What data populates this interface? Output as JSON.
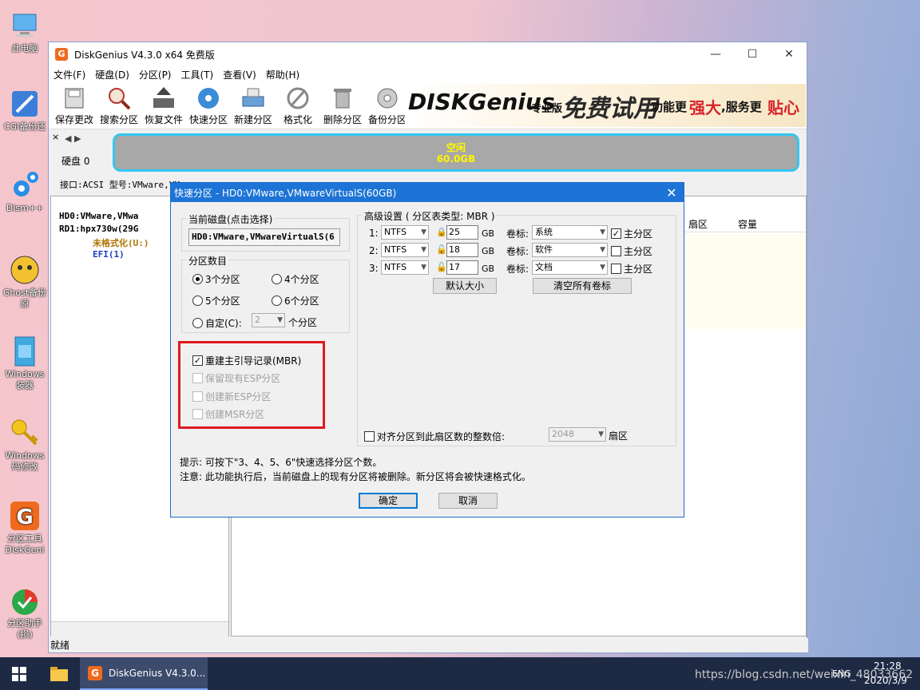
{
  "desktop": {
    "icons": [
      {
        "label": "此电脑"
      },
      {
        "label": "CGI备份还"
      },
      {
        "label": "Dism++"
      },
      {
        "label": "Ghost备份原"
      },
      {
        "label": "Windows装器"
      },
      {
        "label": "Windows码修改"
      },
      {
        "label": "分区工具DiskGeni"
      },
      {
        "label": "分区助手(损)"
      }
    ]
  },
  "window": {
    "title": "DiskGenius V4.3.0 x64 免费版",
    "controls": {
      "minimize": "—",
      "maximize": "☐",
      "close": "✕"
    },
    "menu": [
      "文件(F)",
      "硬盘(D)",
      "分区(P)",
      "工具(T)",
      "查看(V)",
      "帮助(H)"
    ],
    "toolbar": [
      "保存更改",
      "搜索分区",
      "恢复文件",
      "快速分区",
      "新建分区",
      "格式化",
      "删除分区",
      "备份分区"
    ],
    "banner": {
      "logo": "DISKGenius",
      "edition": "专业版",
      "promo": "免费试用",
      "slogan_a": "功能更",
      "slogan_b": "强大",
      "slogan_c": ",服务更",
      "slogan_d": "贴心"
    },
    "disk_label": "硬盘 0",
    "disk_bar": {
      "line1": "空闲",
      "line2": "60.0GB"
    },
    "disk_info": "接口:ACSI  型号:VMware,VM...",
    "tree": [
      {
        "label": "HD0:VMware,VMwa"
      },
      {
        "label": "RD1:hpx730w(29G"
      },
      {
        "label": "未格式化(U:)"
      },
      {
        "label": "EFI(1)"
      }
    ],
    "columns": [
      "扇区",
      "容量"
    ],
    "status": "就绪"
  },
  "dialog": {
    "title": "快速分区 - HD0:VMware,VMwareVirtualS(60GB)",
    "close": "✕",
    "current_disk_label": "当前磁盘(点击选择)",
    "current_disk_value": "HD0:VMware,VMwareVirtualS(6",
    "count_group_label": "分区数目",
    "radios": [
      "3个分区",
      "4个分区",
      "5个分区",
      "6个分区",
      "自定(C):"
    ],
    "custom_count": "2",
    "custom_suffix": "个分区",
    "options": [
      "重建主引导记录(MBR)",
      "保留现有ESP分区",
      "创建新ESP分区",
      "创建MSR分区"
    ],
    "advanced_label": "高级设置 ( 分区表类型: MBR )",
    "rows": [
      {
        "num": "1:",
        "fs": "NTFS",
        "size": "25",
        "unit": "GB",
        "vol_label": "卷标:",
        "vol": "系统",
        "primary": "主分区"
      },
      {
        "num": "2:",
        "fs": "NTFS",
        "size": "18",
        "unit": "GB",
        "vol_label": "卷标:",
        "vol": "软件",
        "primary": "主分区"
      },
      {
        "num": "3:",
        "fs": "NTFS",
        "size": "17",
        "unit": "GB",
        "vol_label": "卷标:",
        "vol": "文档",
        "primary": "主分区"
      }
    ],
    "default_size_btn": "默认大小",
    "clear_labels_btn": "清空所有卷标",
    "align_label": "对齐分区到此扇区数的整数倍:",
    "align_value": "2048",
    "align_unit": "扇区",
    "tip1": "提示: 可按下\"3、4、5、6\"快速选择分区个数。",
    "tip2": "注意: 此功能执行后，当前磁盘上的现有分区将被删除。新分区将会被快速格式化。",
    "ok": "确定",
    "cancel": "取消"
  },
  "taskbar": {
    "app_label": "DiskGenius V4.3.0...",
    "url_watermark": "https://blog.csdn.net/weixin_48033662",
    "lang": "ENG",
    "time": "21:28",
    "date": "2020/3/9"
  },
  "colors": {
    "accent": "#1d74d6",
    "highlight_box": "#e0191f",
    "disk_bar": "#a8a8a8",
    "disk_bar_border": "#32c8f0"
  }
}
